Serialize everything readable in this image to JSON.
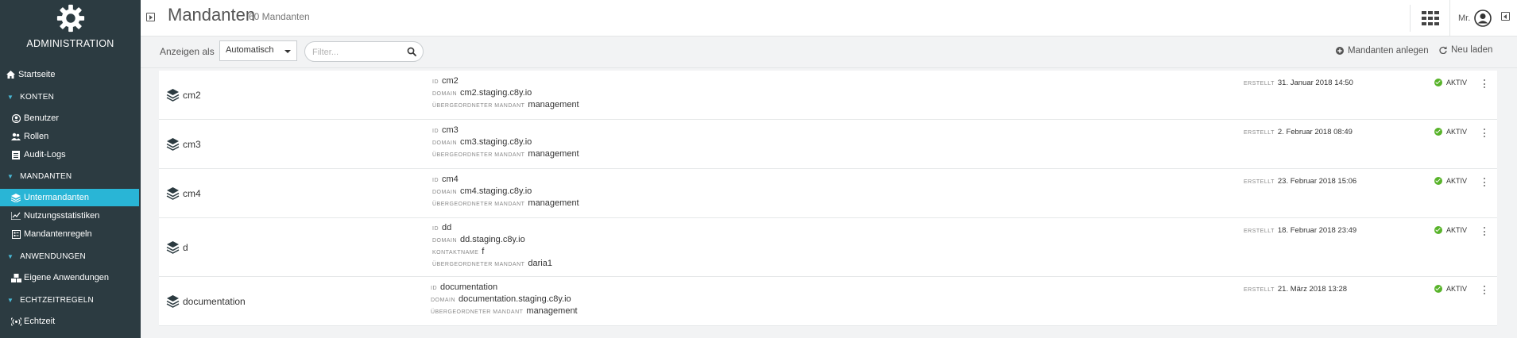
{
  "sidebar": {
    "brand_title": "ADMINISTRATION",
    "items": [
      {
        "label": "Startseite",
        "icon": "home-icon"
      },
      {
        "label": "KONTEN",
        "type": "section"
      },
      {
        "label": "Benutzer",
        "icon": "user-icon"
      },
      {
        "label": "Rollen",
        "icon": "users-icon"
      },
      {
        "label": "Audit-Logs",
        "icon": "list-icon"
      },
      {
        "label": "MANDANTEN",
        "type": "section"
      },
      {
        "label": "Untermandanten",
        "icon": "layers-icon",
        "active": true
      },
      {
        "label": "Nutzungsstatistiken",
        "icon": "chart-icon"
      },
      {
        "label": "Mandantenregeln",
        "icon": "rules-icon"
      },
      {
        "label": "ANWENDUNGEN",
        "type": "section"
      },
      {
        "label": "Eigene Anwendungen",
        "icon": "cubes-icon"
      },
      {
        "label": "ECHTZEITREGELN",
        "type": "section"
      },
      {
        "label": "Echtzeit",
        "icon": "realtime-icon"
      }
    ]
  },
  "header": {
    "title": "Mandanten",
    "count": "60 Mandanten",
    "user_name": "Mr."
  },
  "toolbar": {
    "view_label": "Anzeigen als",
    "view_value": "Automatisch",
    "filter_placeholder": "Filter...",
    "add_label": "Mandanten anlegen",
    "reload_label": "Neu laden"
  },
  "labels": {
    "id": "ID",
    "domain": "DOMAIN",
    "contact": "KONTAKTNAME",
    "parent": "ÜBERGEORDNETER MANDANT",
    "created": "ERSTELLT"
  },
  "tenants": [
    {
      "name": "cm2",
      "id": "cm2",
      "domain": "cm2.staging.c8y.io",
      "parent": "management",
      "created": "31. Januar 2018 14:50",
      "status": "AKTIV"
    },
    {
      "name": "cm3",
      "id": "cm3",
      "domain": "cm3.staging.c8y.io",
      "parent": "management",
      "created": "2. Februar 2018 08:49",
      "status": "AKTIV"
    },
    {
      "name": "cm4",
      "id": "cm4",
      "domain": "cm4.staging.c8y.io",
      "parent": "management",
      "created": "23. Februar 2018 15:06",
      "status": "AKTIV"
    },
    {
      "name": "d",
      "id": "dd",
      "domain": "dd.staging.c8y.io",
      "contact": "f",
      "parent": "daria1",
      "created": "18. Februar 2018 23:49",
      "status": "AKTIV"
    },
    {
      "name": "documentation",
      "id": "documentation",
      "domain": "documentation.staging.c8y.io",
      "parent": "management",
      "created": "21. März 2018 13:28",
      "status": "AKTIV"
    }
  ],
  "colors": {
    "sidebar_bg": "#2c3b41",
    "accent": "#29b5d6",
    "active_status": "#58b32a"
  }
}
